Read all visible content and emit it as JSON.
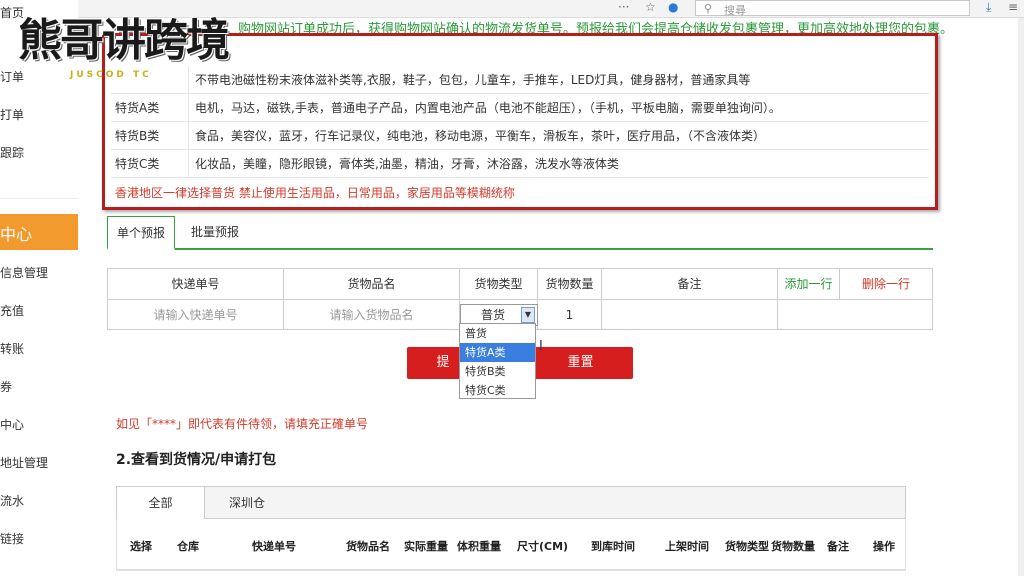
{
  "browser": {
    "search_placeholder": "搜尋",
    "search_icon": "search-icon",
    "download_icon": "download-icon",
    "menu_icon": "more-icon"
  },
  "watermark": {
    "main": "熊哥讲跨境",
    "sub": "JUSCOD TC"
  },
  "sidebar": {
    "items": [
      {
        "label": "首页"
      },
      {
        "label": "订单"
      },
      {
        "label": "打单"
      },
      {
        "label": "跟踪"
      },
      {
        "label": "中心"
      },
      {
        "label": "信息管理"
      },
      {
        "label": "充值"
      },
      {
        "label": "转账"
      },
      {
        "label": "券"
      },
      {
        "label": "中心"
      },
      {
        "label": "地址管理"
      },
      {
        "label": "流水"
      },
      {
        "label": "链接"
      }
    ]
  },
  "notice": "购物网站订单成功后，获得购物网站确认的物流发货单号。预报给我们会提高仓储收发包裹管理，更加高效地处理您的包裹。",
  "categories": [
    {
      "label": "",
      "desc": "不带电池磁性粉末液体滋补类等,衣服，鞋子，包包，儿童车，手推车，LED灯具，健身器材，普通家具等"
    },
    {
      "label": "特货A类",
      "desc": "电机，马达，磁铁,手表，普通电子产品，内置电池产品（电池不能超压），（手机，平板电脑，需要单独询问）。"
    },
    {
      "label": "特货B类",
      "desc": "食品，美容仪，蓝牙，行车记录仪，纯电池，移动电源，平衡车，滑板车，茶叶，医疗用品，（不含液体类）"
    },
    {
      "label": "特货C类",
      "desc": "化妆品，美瞳，隐形眼镜，膏体类,油墨，精油，牙膏，沐浴露，洗发水等液体类"
    }
  ],
  "cat_warning": "香港地区一律选择普货 禁止使用生活用品，日常用品，家居用品等模糊统称",
  "tabs": [
    {
      "label": "单个预报"
    },
    {
      "label": "批量预报"
    }
  ],
  "entry": {
    "headers": {
      "tracking": "快递单号",
      "goods": "货物品名",
      "type": "货物类型",
      "qty": "货物数量",
      "remark": "备注",
      "add": "添加一行",
      "del": "删除一行"
    },
    "tracking_placeholder": "请输入快递单号",
    "goods_placeholder": "请输入货物品名",
    "type_value": "普货",
    "qty_value": "1"
  },
  "dropdown_options": [
    {
      "label": "普货",
      "highlighted": false
    },
    {
      "label": "特货A类",
      "highlighted": true
    },
    {
      "label": "特货B类",
      "highlighted": false
    },
    {
      "label": "特货C类",
      "highlighted": false
    }
  ],
  "buttons": {
    "submit": "提",
    "reset": "重置"
  },
  "note": "如见「****」即代表有件待领，请填充正確单号",
  "section_title": "2.查看到货情况/申请打包",
  "bottom_tabs": [
    {
      "label": "全部"
    },
    {
      "label": "深圳仓"
    }
  ],
  "columns": [
    "选择",
    "仓库",
    "快递单号",
    "货物品名",
    "实际重量",
    "体积重量",
    "尺寸(CM)",
    "到库时间",
    "上架时间",
    "货物类型",
    "货物数量",
    "备注",
    "操作"
  ],
  "colors": {
    "accent_green": "#3aa23a",
    "red": "#d61e1e",
    "orange": "#f39a2e",
    "highlight_blue": "#3a7ee0"
  }
}
